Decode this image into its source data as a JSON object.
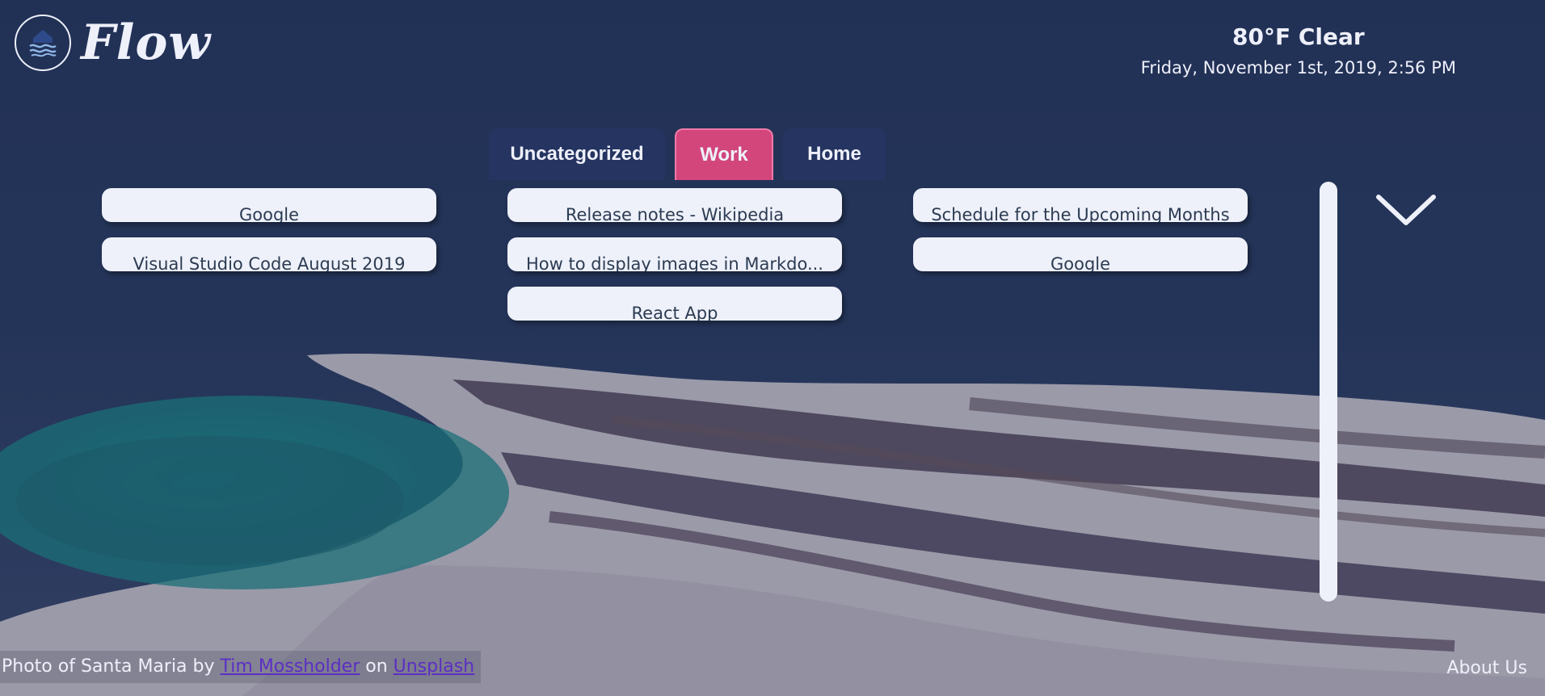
{
  "app": {
    "name": "Flow"
  },
  "weather": {
    "summary": "80°F Clear",
    "datetime": "Friday, November 1st, 2019, 2:56 PM"
  },
  "tabs": [
    {
      "label": "Uncategorized",
      "active": false
    },
    {
      "label": "Work",
      "active": true
    },
    {
      "label": "Home",
      "active": false
    }
  ],
  "bookmarks": {
    "column1": [
      "Google",
      "Visual Studio Code August 2019"
    ],
    "column2": [
      "Release notes - Wikipedia",
      "How to display images in Markdo...",
      "React App"
    ],
    "column3": [
      "Schedule for the Upcoming Months",
      "Google"
    ]
  },
  "footer": {
    "credit_prefix": "Photo of Santa Maria by ",
    "photographer": "Tim Mossholder",
    "credit_mid": " on ",
    "source": "Unsplash",
    "about_label": "About Us"
  },
  "icons": {
    "logo": "house-waves-icon",
    "chevron": "chevron-down-icon"
  },
  "colors": {
    "active_tab": "#d2467c",
    "inactive_tab": "#253460",
    "card": "#eef1fa",
    "link": "#5b2fc4"
  }
}
